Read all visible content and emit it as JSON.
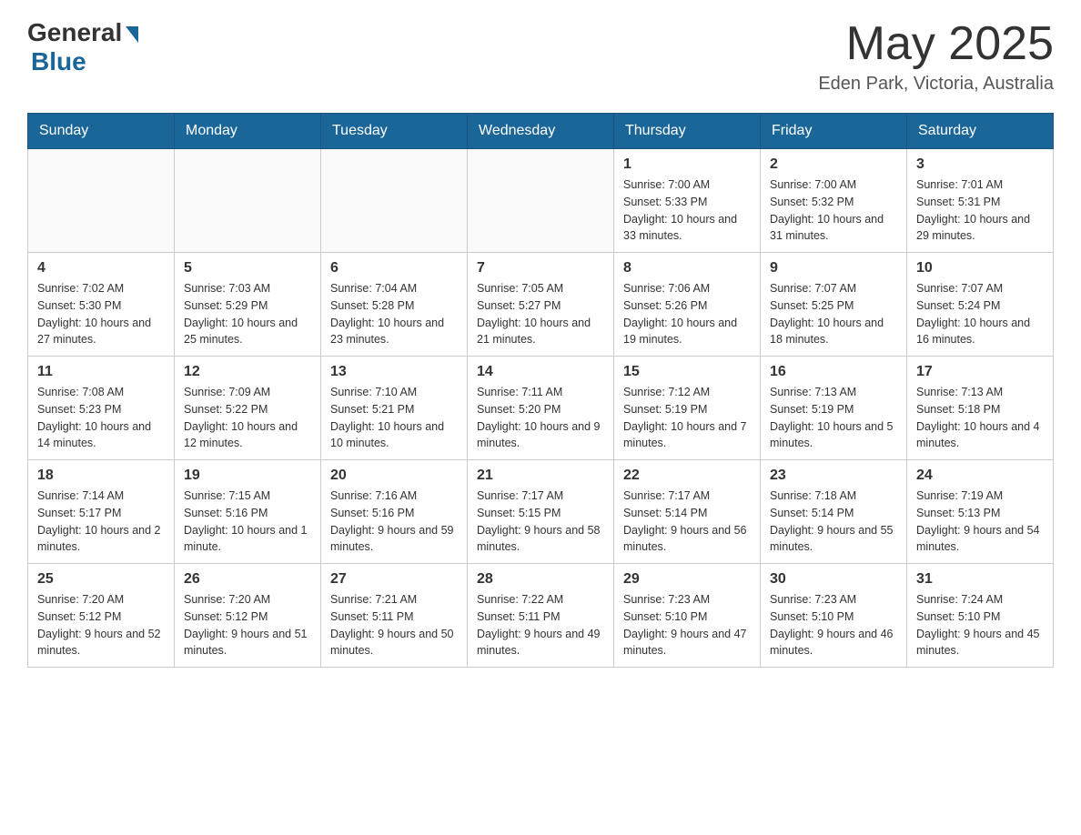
{
  "header": {
    "logo_general": "General",
    "logo_blue": "Blue",
    "month_year": "May 2025",
    "location": "Eden Park, Victoria, Australia"
  },
  "days_of_week": [
    "Sunday",
    "Monday",
    "Tuesday",
    "Wednesday",
    "Thursday",
    "Friday",
    "Saturday"
  ],
  "weeks": [
    [
      {
        "day": "",
        "info": ""
      },
      {
        "day": "",
        "info": ""
      },
      {
        "day": "",
        "info": ""
      },
      {
        "day": "",
        "info": ""
      },
      {
        "day": "1",
        "info": "Sunrise: 7:00 AM\nSunset: 5:33 PM\nDaylight: 10 hours and 33 minutes."
      },
      {
        "day": "2",
        "info": "Sunrise: 7:00 AM\nSunset: 5:32 PM\nDaylight: 10 hours and 31 minutes."
      },
      {
        "day": "3",
        "info": "Sunrise: 7:01 AM\nSunset: 5:31 PM\nDaylight: 10 hours and 29 minutes."
      }
    ],
    [
      {
        "day": "4",
        "info": "Sunrise: 7:02 AM\nSunset: 5:30 PM\nDaylight: 10 hours and 27 minutes."
      },
      {
        "day": "5",
        "info": "Sunrise: 7:03 AM\nSunset: 5:29 PM\nDaylight: 10 hours and 25 minutes."
      },
      {
        "day": "6",
        "info": "Sunrise: 7:04 AM\nSunset: 5:28 PM\nDaylight: 10 hours and 23 minutes."
      },
      {
        "day": "7",
        "info": "Sunrise: 7:05 AM\nSunset: 5:27 PM\nDaylight: 10 hours and 21 minutes."
      },
      {
        "day": "8",
        "info": "Sunrise: 7:06 AM\nSunset: 5:26 PM\nDaylight: 10 hours and 19 minutes."
      },
      {
        "day": "9",
        "info": "Sunrise: 7:07 AM\nSunset: 5:25 PM\nDaylight: 10 hours and 18 minutes."
      },
      {
        "day": "10",
        "info": "Sunrise: 7:07 AM\nSunset: 5:24 PM\nDaylight: 10 hours and 16 minutes."
      }
    ],
    [
      {
        "day": "11",
        "info": "Sunrise: 7:08 AM\nSunset: 5:23 PM\nDaylight: 10 hours and 14 minutes."
      },
      {
        "day": "12",
        "info": "Sunrise: 7:09 AM\nSunset: 5:22 PM\nDaylight: 10 hours and 12 minutes."
      },
      {
        "day": "13",
        "info": "Sunrise: 7:10 AM\nSunset: 5:21 PM\nDaylight: 10 hours and 10 minutes."
      },
      {
        "day": "14",
        "info": "Sunrise: 7:11 AM\nSunset: 5:20 PM\nDaylight: 10 hours and 9 minutes."
      },
      {
        "day": "15",
        "info": "Sunrise: 7:12 AM\nSunset: 5:19 PM\nDaylight: 10 hours and 7 minutes."
      },
      {
        "day": "16",
        "info": "Sunrise: 7:13 AM\nSunset: 5:19 PM\nDaylight: 10 hours and 5 minutes."
      },
      {
        "day": "17",
        "info": "Sunrise: 7:13 AM\nSunset: 5:18 PM\nDaylight: 10 hours and 4 minutes."
      }
    ],
    [
      {
        "day": "18",
        "info": "Sunrise: 7:14 AM\nSunset: 5:17 PM\nDaylight: 10 hours and 2 minutes."
      },
      {
        "day": "19",
        "info": "Sunrise: 7:15 AM\nSunset: 5:16 PM\nDaylight: 10 hours and 1 minute."
      },
      {
        "day": "20",
        "info": "Sunrise: 7:16 AM\nSunset: 5:16 PM\nDaylight: 9 hours and 59 minutes."
      },
      {
        "day": "21",
        "info": "Sunrise: 7:17 AM\nSunset: 5:15 PM\nDaylight: 9 hours and 58 minutes."
      },
      {
        "day": "22",
        "info": "Sunrise: 7:17 AM\nSunset: 5:14 PM\nDaylight: 9 hours and 56 minutes."
      },
      {
        "day": "23",
        "info": "Sunrise: 7:18 AM\nSunset: 5:14 PM\nDaylight: 9 hours and 55 minutes."
      },
      {
        "day": "24",
        "info": "Sunrise: 7:19 AM\nSunset: 5:13 PM\nDaylight: 9 hours and 54 minutes."
      }
    ],
    [
      {
        "day": "25",
        "info": "Sunrise: 7:20 AM\nSunset: 5:12 PM\nDaylight: 9 hours and 52 minutes."
      },
      {
        "day": "26",
        "info": "Sunrise: 7:20 AM\nSunset: 5:12 PM\nDaylight: 9 hours and 51 minutes."
      },
      {
        "day": "27",
        "info": "Sunrise: 7:21 AM\nSunset: 5:11 PM\nDaylight: 9 hours and 50 minutes."
      },
      {
        "day": "28",
        "info": "Sunrise: 7:22 AM\nSunset: 5:11 PM\nDaylight: 9 hours and 49 minutes."
      },
      {
        "day": "29",
        "info": "Sunrise: 7:23 AM\nSunset: 5:10 PM\nDaylight: 9 hours and 47 minutes."
      },
      {
        "day": "30",
        "info": "Sunrise: 7:23 AM\nSunset: 5:10 PM\nDaylight: 9 hours and 46 minutes."
      },
      {
        "day": "31",
        "info": "Sunrise: 7:24 AM\nSunset: 5:10 PM\nDaylight: 9 hours and 45 minutes."
      }
    ]
  ]
}
